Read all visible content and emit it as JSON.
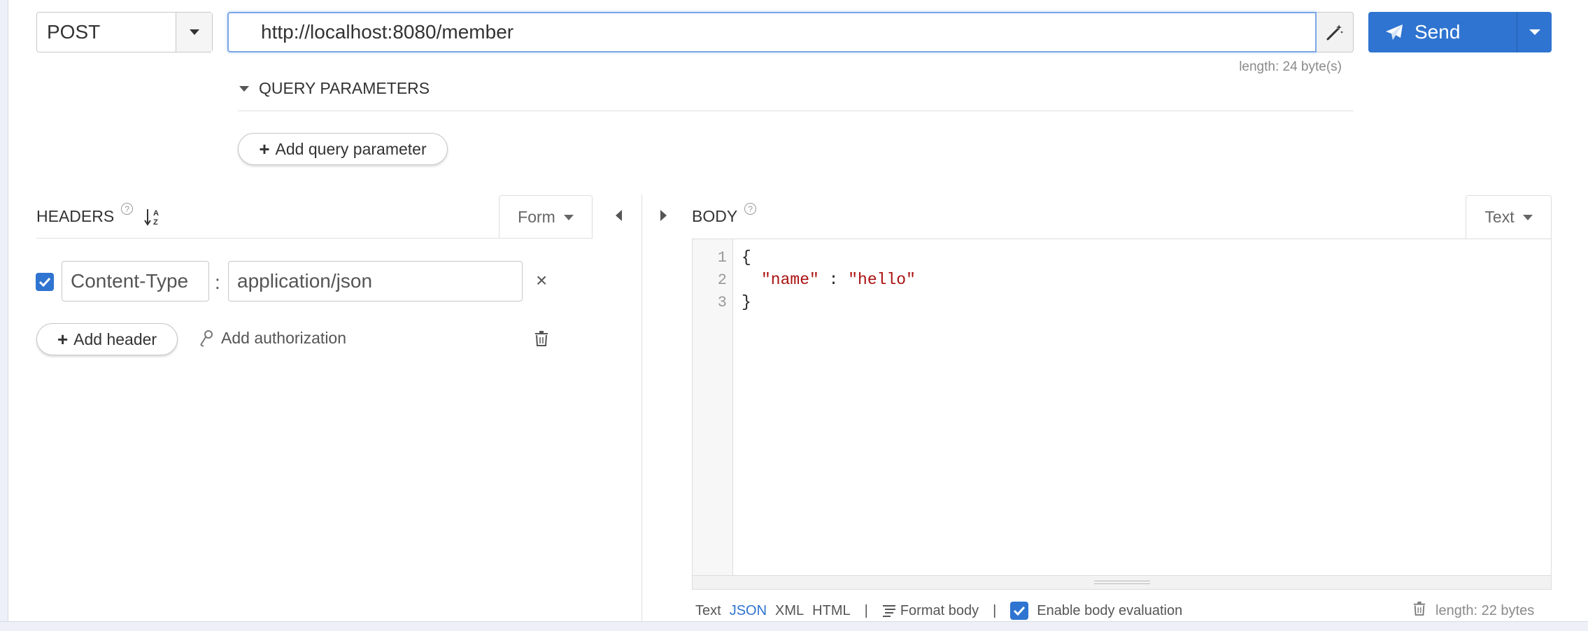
{
  "request": {
    "method": "POST",
    "url": "http://localhost:8080/member",
    "url_length": "length: 24 byte(s)",
    "send_label": "Send"
  },
  "query": {
    "title": "QUERY PARAMETERS",
    "add_label": "Add query parameter"
  },
  "headers": {
    "title": "HEADERS",
    "mode_label": "Form",
    "rows": [
      {
        "enabled": true,
        "key": "Content-Type",
        "separator": ":",
        "value": "application/json"
      }
    ],
    "add_label": "Add header",
    "auth_label": "Add authorization"
  },
  "body": {
    "title": "BODY",
    "mode_label": "Text",
    "lines": [
      {
        "num": "1",
        "text": "{"
      },
      {
        "num": "2",
        "key": "\"name\"",
        "sep": " : ",
        "value": "\"hello\""
      },
      {
        "num": "3",
        "text": "}"
      }
    ],
    "formats": [
      "Text",
      "JSON",
      "XML",
      "HTML"
    ],
    "active_format": "JSON",
    "format_label": "Format body",
    "eval_label": "Enable body evaluation",
    "length": "length: 22 bytes"
  },
  "colors": {
    "accent": "#2f74d0",
    "string": "#aa1111"
  }
}
